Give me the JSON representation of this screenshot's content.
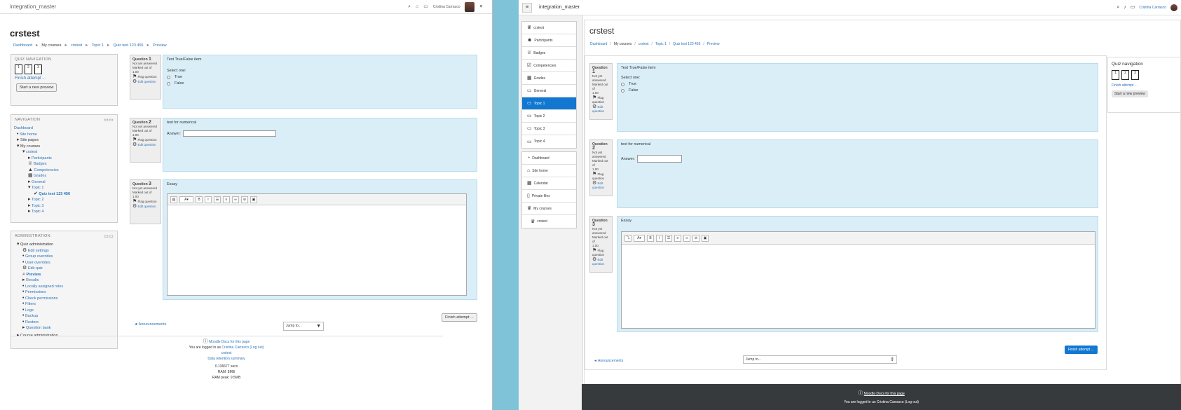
{
  "left": {
    "site": "integration_master",
    "user": "Cristina Carrasco",
    "title": "crstest",
    "breadcrumb": [
      "Dashboard",
      "My courses",
      "crstest",
      "Topic 1",
      "Quiz test 123 456",
      "Preview"
    ],
    "quiznav": {
      "heading": "QUIZ NAVIGATION",
      "cells": [
        "1",
        "2",
        "3"
      ],
      "finish": "Finish attempt ...",
      "start": "Start a new preview"
    },
    "navigation": {
      "heading": "NAVIGATION",
      "items": [
        "Dashboard",
        "Site home",
        "Site pages",
        "My courses",
        "crstest",
        "Participants",
        "Badges",
        "Competencies",
        "Grades",
        "General",
        "Topic 1",
        "Quiz test 123 456",
        "Topic 2",
        "Topic 3",
        "Topic 4"
      ]
    },
    "admin": {
      "heading": "ADMINISTRATION",
      "items": [
        "Quiz administration",
        "Edit settings",
        "Group overrides",
        "User overrides",
        "Edit quiz",
        "Preview",
        "Results",
        "Locally assigned roles",
        "Permissions",
        "Check permissions",
        "Filters",
        "Logs",
        "Backup",
        "Restore",
        "Question bank",
        "Course administration"
      ]
    },
    "q1": {
      "label": "Question",
      "num": "1",
      "status": "Not yet answered",
      "marked": "Marked out of",
      "mark": "1.00",
      "flag": "Flag question",
      "edit": "Edit question",
      "text": "Test True/False item",
      "select": "Select one:",
      "opt1": "True",
      "opt2": "False"
    },
    "q2": {
      "label": "Question",
      "num": "2",
      "status": "Not yet answered",
      "marked": "Marked out of",
      "mark": "1.00",
      "flag": "Flag question",
      "edit": "Edit question",
      "text": "test for numerical",
      "answer": "Answer:"
    },
    "q3": {
      "label": "Question",
      "num": "3",
      "status": "Not yet answered",
      "marked": "Marked out of",
      "mark": "1.00",
      "flag": "Flag question",
      "edit": "Edit question",
      "text": "Essay"
    },
    "finish_btn": "Finish attempt ...",
    "prev_link": "◄ Announcements",
    "jump": "Jump to...",
    "footer": {
      "docs": "Moodle Docs for this page",
      "logged": "You are logged in as",
      "user": "Cristina Carrasco",
      "logout": "(Log out)",
      "course": "crstest",
      "retention": "Data retention summary",
      "secs": "0.136677 secs",
      "ram": "RAM: 8MB",
      "peak": "RAM peak: 9.5MB"
    }
  },
  "right": {
    "site": "integration_master",
    "user": "Cristina Carrasco",
    "title": "crstest",
    "breadcrumb": [
      "Dashboard",
      "My courses",
      "crstest",
      "Topic 1",
      "Quiz test 123 456",
      "Preview"
    ],
    "drawer1": [
      "crstest",
      "Participants",
      "Badges",
      "Competencies",
      "Grades",
      "General",
      "Topic 1",
      "Topic 2",
      "Topic 3",
      "Topic 4"
    ],
    "drawer2": [
      "Dashboard",
      "Site home",
      "Calendar",
      "Private files",
      "My courses",
      "crstest"
    ],
    "quiznav": {
      "heading": "Quiz navigation",
      "cells": [
        "1",
        "2",
        "3"
      ],
      "finish": "Finish attempt ...",
      "start": "Start a new preview"
    },
    "q1": {
      "label": "Question",
      "num": "1",
      "status": "Not yet answered",
      "marked": "Marked out of",
      "mark": "1.00",
      "flag": "Flag question",
      "edit": "Edit question",
      "text": "Test True/False item",
      "select": "Select one:",
      "opt1": "True",
      "opt2": "False"
    },
    "q2": {
      "label": "Question",
      "num": "2",
      "status": "Not yet answered",
      "marked": "Marked out of",
      "mark": "1.00",
      "flag": "Flag question",
      "edit": "Edit question",
      "text": "test for numerical",
      "answer": "Answer:"
    },
    "q3": {
      "label": "Question",
      "num": "3",
      "status": "Not yet answered",
      "marked": "Marked out of",
      "mark": "1.00",
      "flag": "Flag question",
      "edit": "Edit question",
      "text": "Essay"
    },
    "finish_btn": "Finish attempt ...",
    "prev_link": "◄ Announcements",
    "jump": "Jump to...",
    "footer": {
      "docs": "Moodle Docs for this page",
      "logged": "You are logged in as Cristina Carrasco (Log out)"
    }
  }
}
